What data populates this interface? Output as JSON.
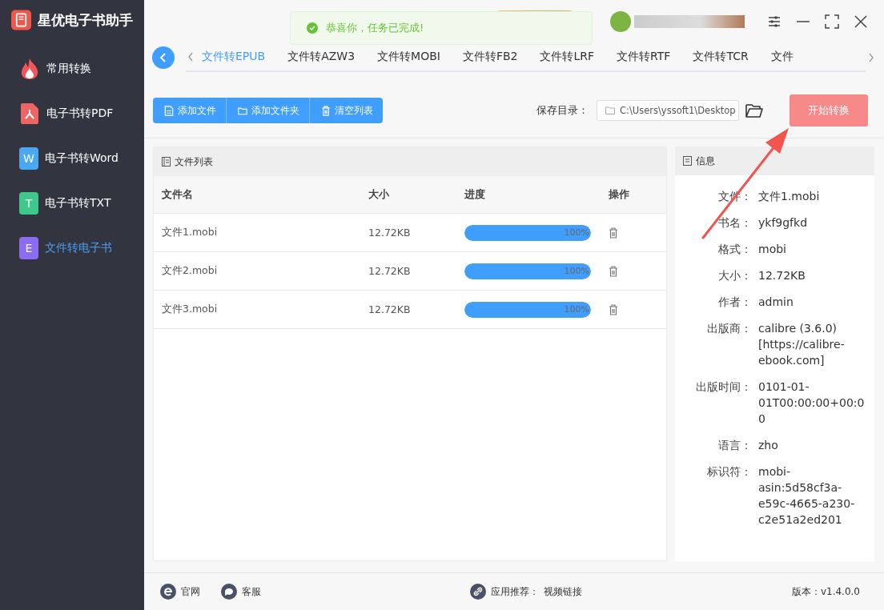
{
  "app": {
    "title": "星优电子书助手"
  },
  "sidebar": {
    "items": [
      {
        "label": "常用转换",
        "kind": "fire",
        "selected": false
      },
      {
        "label": "电子书转PDF",
        "kind": "pdf",
        "selected": false
      },
      {
        "label": "电子书转Word",
        "kind": "letter",
        "icon_letter": "W",
        "color": "#4aa8f0",
        "selected": false
      },
      {
        "label": "电子书转TXT",
        "kind": "letter",
        "icon_letter": "T",
        "color": "#3ec88b",
        "selected": false
      },
      {
        "label": "文件转电子书",
        "kind": "letter",
        "icon_letter": "E",
        "color": "#8b6cf0",
        "selected": true
      }
    ]
  },
  "toast": {
    "message": "恭喜你，任务已完成!"
  },
  "tabs": [
    {
      "label": "文件转EPUB",
      "selected": true
    },
    {
      "label": "文件转AZW3",
      "selected": false
    },
    {
      "label": "文件转MOBI",
      "selected": false
    },
    {
      "label": "文件转FB2",
      "selected": false
    },
    {
      "label": "文件转LRF",
      "selected": false
    },
    {
      "label": "文件转RTF",
      "selected": false
    },
    {
      "label": "文件转TCR",
      "selected": false
    },
    {
      "label": "文件",
      "selected": false
    }
  ],
  "toolbar": {
    "buttons": [
      {
        "label": "添加文件",
        "kind": "file"
      },
      {
        "label": "添加文件夹",
        "kind": "folder"
      },
      {
        "label": "清空列表",
        "kind": "trash"
      }
    ],
    "save_label": "保存目录：",
    "save_path": "C:\\Users\\yssoft1\\Desktop",
    "start_button": "开始转换"
  },
  "file_list": {
    "title": "文件列表",
    "columns": [
      "文件名",
      "大小",
      "进度",
      "操作"
    ],
    "rows": [
      {
        "name": "文件1.mobi",
        "size": "12.72KB",
        "level": 1,
        "progress_text": "100%"
      },
      {
        "name": "文件2.mobi",
        "size": "12.72KB",
        "level": 1,
        "progress_text": "100%"
      },
      {
        "name": "文件3.mobi",
        "size": "12.72KB",
        "level": 1,
        "progress_text": "100%"
      }
    ]
  },
  "info": {
    "title": "信息",
    "fields": [
      {
        "label": "文件：",
        "value": "文件1.mobi"
      },
      {
        "label": "书名：",
        "value": "ykf9gfkd"
      },
      {
        "label": "格式：",
        "value": "mobi"
      },
      {
        "label": "大小：",
        "value": "12.72KB"
      },
      {
        "label": "作者：",
        "value": "admin"
      },
      {
        "label": "出版商：",
        "value": "calibre (3.6.0) [https://calibre-ebook.com]"
      },
      {
        "label": "出版时间：",
        "value": "0101-01-01T00:00:00+00:00"
      },
      {
        "label": "语言：",
        "value": "zho"
      },
      {
        "label": "标识符：",
        "value": "mobi-asin:5d58cf3a-e59c-4665-a230-c2e51a2ed201"
      }
    ]
  },
  "footer": {
    "website": "官网",
    "support": "客服",
    "recommend_label": "应用推荐：",
    "recommend_link": "视频链接",
    "version": "版本：v1.4.0.0"
  }
}
